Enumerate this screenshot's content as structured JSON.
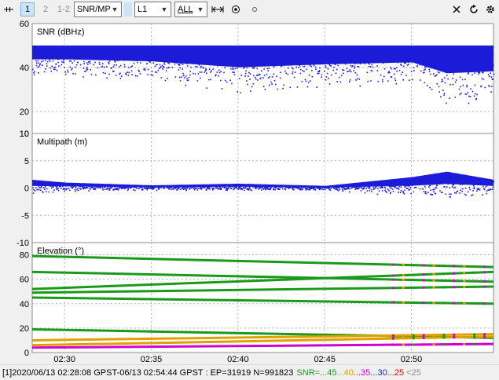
{
  "toolbar": {
    "plot_btn_1": "1",
    "plot_btn_2": "2",
    "plot_btn_12": "1-2",
    "plot_type": "SNR/MP",
    "freq": "L1",
    "sat": "ALL",
    "icons": [
      "drag-handle-icon",
      "fit-horizontal-icon",
      "center-target-icon",
      "small-dot-icon",
      "close-icon",
      "reload-icon",
      "gear-icon"
    ]
  },
  "status": {
    "prefix": "[1]2020/06/13 02:28:08 GPST-06/13 02:54:44 GPST : EP=31919 N=991823",
    "snr_label": "SNR=",
    "snr_levels": [
      {
        "text": "...45",
        "color": "#1a9a1a"
      },
      {
        "text": "...40",
        "color": "#e0a000"
      },
      {
        "text": "...35",
        "color": "#d000d0"
      },
      {
        "text": "...30",
        "color": "#1c1cd8"
      },
      {
        "text": "...25",
        "color": "#e00000"
      },
      {
        "text": " <25",
        "color": "#8c8c8c"
      }
    ]
  },
  "chart_data": [
    {
      "type": "scatter",
      "title": "SNR (dBHz)",
      "ylim": [
        10,
        60
      ],
      "yticks": [
        "60",
        "40",
        "20",
        "10"
      ],
      "grid": true,
      "series": [
        {
          "color": "#1c1cd8",
          "x": [
            "02:28:08",
            "02:30",
            "02:35",
            "02:40",
            "02:45",
            "02:50",
            "02:52",
            "02:54:44"
          ],
          "y_max": [
            50,
            50,
            50,
            50,
            50,
            50,
            50,
            50
          ],
          "y_min": [
            36,
            36,
            34,
            28,
            31,
            33,
            22,
            24
          ]
        }
      ]
    },
    {
      "type": "scatter",
      "title": "Multipath (m)",
      "ylim": [
        -10,
        10
      ],
      "yticks": [
        "10",
        "5",
        "0",
        "-5",
        "-10"
      ],
      "grid": true,
      "series": [
        {
          "color": "#1c1cd8",
          "x": [
            "02:28:08",
            "02:30",
            "02:35",
            "02:40",
            "02:45",
            "02:50",
            "02:52",
            "02:54:44"
          ],
          "y_min": [
            -1,
            -0.5,
            -0.3,
            -0.4,
            -0.3,
            -1.5,
            -2,
            -1
          ],
          "y_max": [
            1.5,
            1,
            0.5,
            0.8,
            0.4,
            2,
            3,
            1.5
          ]
        }
      ]
    },
    {
      "type": "line",
      "title": "Elevation (°)",
      "ylim": [
        0,
        90
      ],
      "yticks": [
        "80",
        "60",
        "40",
        "20",
        "0"
      ],
      "xticks": [
        "02:30",
        "02:35",
        "02:40",
        "02:45",
        "02:50"
      ],
      "grid": true,
      "series": [
        {
          "color": "#1a9a1a",
          "x": [
            "02:28:08",
            "02:54:44"
          ],
          "y": [
            79,
            70
          ]
        },
        {
          "color": "#1a9a1a",
          "x": [
            "02:28:08",
            "02:54:44"
          ],
          "y": [
            66,
            58
          ]
        },
        {
          "color": "#1a9a1a",
          "x": [
            "02:28:08",
            "02:54:44"
          ],
          "y": [
            52,
            66
          ]
        },
        {
          "color": "#1a9a1a",
          "x": [
            "02:28:08",
            "02:54:44"
          ],
          "y": [
            49,
            54
          ]
        },
        {
          "color": "#1a9a1a",
          "x": [
            "02:28:08",
            "02:54:44"
          ],
          "y": [
            45,
            40
          ]
        },
        {
          "color": "#1a9a1a",
          "x": [
            "02:28:08",
            "02:54:44"
          ],
          "y": [
            19,
            12
          ]
        },
        {
          "color": "#e0a000",
          "x": [
            "02:28:08",
            "02:54:44"
          ],
          "y": [
            10,
            15
          ]
        },
        {
          "color": "#e0a000",
          "x": [
            "02:28:08",
            "02:54:44"
          ],
          "y": [
            6,
            13
          ]
        },
        {
          "color": "#d000d0",
          "x": [
            "02:28:08",
            "02:54:44"
          ],
          "y": [
            4,
            7
          ]
        }
      ]
    }
  ]
}
